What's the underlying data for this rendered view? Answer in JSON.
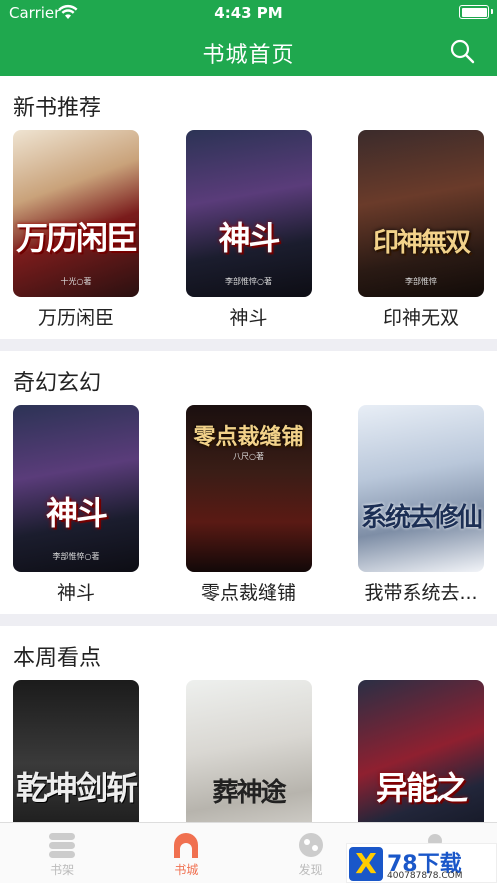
{
  "status_bar": {
    "carrier": "Carrier",
    "time": "4:43 PM"
  },
  "nav": {
    "title": "书城首页"
  },
  "sections": [
    {
      "title": "新书推荐",
      "books": [
        {
          "name": "万历闲臣",
          "cover_title": "万历闲臣",
          "cover_author": "十光○著"
        },
        {
          "name": "神斗",
          "cover_title": "神斗",
          "cover_author": "李部惟悴○著"
        },
        {
          "name": "印神无双",
          "cover_title": "印神無双",
          "cover_author": "李部惟悴"
        }
      ]
    },
    {
      "title": "奇幻玄幻",
      "books": [
        {
          "name": "神斗",
          "cover_title": "神斗",
          "cover_author": "李部惟悴○著"
        },
        {
          "name": "零点裁缝铺",
          "cover_title": "零点裁缝铺",
          "cover_author": "八尺○著"
        },
        {
          "name": "我带系统去...",
          "cover_title": "系统去修仙",
          "cover_author": ""
        }
      ]
    },
    {
      "title": "本周看点",
      "books": [
        {
          "name": "",
          "cover_title": "乾坤剑斩",
          "cover_author": ""
        },
        {
          "name": "",
          "cover_title": "葬神途",
          "cover_author": ""
        },
        {
          "name": "",
          "cover_title": "异能之",
          "cover_author": ""
        }
      ]
    }
  ],
  "tabs": [
    {
      "label": "书架",
      "icon": "bookshelf-icon",
      "active": false
    },
    {
      "label": "书城",
      "icon": "bookstore-icon",
      "active": true
    },
    {
      "label": "发现",
      "icon": "discover-icon",
      "active": false
    },
    {
      "label": "",
      "icon": "profile-icon",
      "active": false
    }
  ],
  "watermark": {
    "logo": "X",
    "text": "78下载",
    "url": "400787878.COM"
  },
  "colors": {
    "header": "#1fa84e",
    "tab_active": "#f07050",
    "tab_inactive": "#bbbbbb"
  }
}
